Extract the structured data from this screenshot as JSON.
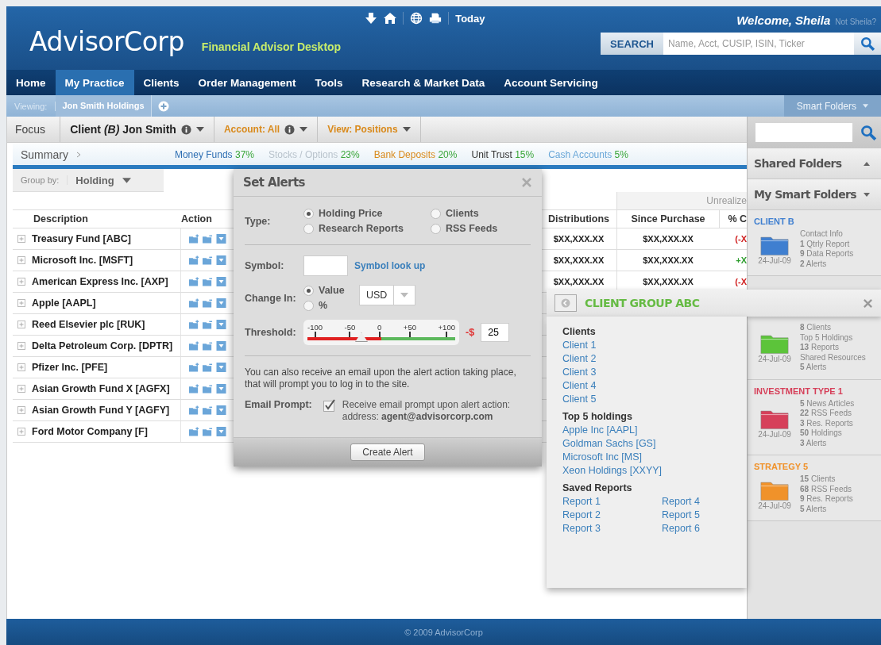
{
  "header": {
    "logo": "AdvisorCorp",
    "tagline": "Financial Advisor Desktop",
    "today": "Today",
    "welcome": "Welcome, Sheila",
    "not_user": "Not Sheila?",
    "search": {
      "button": "SEARCH",
      "placeholder": "Name, Acct, CUSIP, ISIN, Ticker"
    }
  },
  "nav": [
    {
      "label": "Home",
      "selected": false
    },
    {
      "label": "My Practice",
      "selected": true
    },
    {
      "label": "Clients",
      "selected": false
    },
    {
      "label": "Order Management",
      "selected": false
    },
    {
      "label": "Tools",
      "selected": false
    },
    {
      "label": "Research & Market Data",
      "selected": false
    },
    {
      "label": "Account Servicing",
      "selected": false
    }
  ],
  "subbar": {
    "viewing_label": "Viewing:",
    "viewing": "Jon Smith Holdings",
    "smart_folders": "Smart Folders"
  },
  "toolbar": {
    "focus": "Focus",
    "client": "Client *(B)* Jon Smith",
    "account": "Account: All",
    "view": "View: Positions"
  },
  "summary": {
    "title": "Summary",
    "items": [
      {
        "label": "Money Funds",
        "pct": "37%",
        "color": "#2f6fb3"
      },
      {
        "label": "Stocks / Options",
        "pct": "23%",
        "color": "#b9c3cc"
      },
      {
        "label": "Bank Deposits",
        "pct": "20%",
        "color": "#d98a1c"
      },
      {
        "label": "Unit Trust",
        "pct": "15%",
        "color": "#333333"
      },
      {
        "label": "Cash Accounts",
        "pct": "5%",
        "color": "#6aa7d8"
      }
    ]
  },
  "group_by": {
    "label": "Group by:",
    "value": "Holding"
  },
  "table": {
    "group_header": "Unrealize",
    "columns": [
      "Description",
      "Action",
      "Distributions",
      "Since Purchase",
      "% C"
    ],
    "rows": [
      {
        "description": "Treasury Fund [ABC]",
        "distributions": "$XX,XXX.XX",
        "since_purchase": "$XX,XXX.XX",
        "change": {
          "text": "(-X",
          "kind": "loss"
        }
      },
      {
        "description": "Microsoft Inc. [MSFT]",
        "distributions": "$XX,XXX.XX",
        "since_purchase": "$XX,XXX.XX",
        "change": {
          "text": "+X",
          "kind": "gain"
        }
      },
      {
        "description": "American Express Inc. [AXP]",
        "distributions": "$XX,XXX.XX",
        "since_purchase": "$XX,XXX.XX",
        "change": {
          "text": "(-X",
          "kind": "loss"
        }
      },
      {
        "description": "Apple [AAPL]"
      },
      {
        "description": "Reed Elsevier plc [RUK]"
      },
      {
        "description": "Delta Petroleum Corp. [DPTR]"
      },
      {
        "description": "Pfizer Inc. [PFE]"
      },
      {
        "description": "Asian Growth Fund X [AGFX]"
      },
      {
        "description": "Asian Growth Fund Y [AGFY]"
      },
      {
        "description": "Ford Motor Company [F]"
      }
    ]
  },
  "set_alerts": {
    "title": "Set Alerts",
    "type_label": "Type:",
    "types": [
      {
        "label": "Holding Price",
        "selected": true
      },
      {
        "label": "Clients",
        "selected": false
      },
      {
        "label": "Research Reports",
        "selected": false
      },
      {
        "label": "RSS Feeds",
        "selected": false
      }
    ],
    "symbol_label": "Symbol:",
    "symbol_link": "Symbol look up",
    "change_label": "Change In:",
    "change_options": [
      {
        "label": "Value",
        "selected": true
      },
      {
        "label": "%",
        "selected": false
      }
    ],
    "currency": "USD",
    "threshold_label": "Threshold:",
    "ticks": [
      "-100",
      "-50",
      "0",
      "+50",
      "+100"
    ],
    "threshold": {
      "level": 0.36,
      "prefix": "-$",
      "value": "25"
    },
    "note": "You can also receive an email upon the alert action taking place, that will prompt you to log in to the site.",
    "email_label": "Email Prompt:",
    "email": {
      "checked": true,
      "text": "Receive email prompt upon alert action: address: **agent@advisorcorp.com**"
    },
    "button": "Create Alert"
  },
  "client_group": {
    "title": "CLIENT GROUP ABC",
    "sections": [
      {
        "heading": "Clients",
        "kind": "list",
        "links": [
          "Client 1",
          "Client 2",
          "Client 3",
          "Client 4",
          "Client 5"
        ]
      },
      {
        "heading": "Top 5 holdings",
        "kind": "list",
        "links": [
          "Apple Inc [AAPL]",
          "Goldman Sachs [GS]",
          "Microsoft Inc [MS]",
          "Xeon Holdings [XXYY]"
        ]
      },
      {
        "heading": "Saved Reports",
        "kind": "grid",
        "links": [
          "Report 1",
          "Report 2",
          "Report 3",
          "Report 4",
          "Report 5",
          "Report 6"
        ]
      }
    ]
  },
  "sidebar": {
    "sections": [
      {
        "label": "Shared Folders",
        "expanded": false
      },
      {
        "label": "My Smart Folders",
        "expanded": true
      }
    ],
    "folders": [
      {
        "title": "CLIENT B",
        "color": "#3f7fd0",
        "date": "24-Jul-09",
        "lines": [
          "Contact Info",
          "**1** Qtrly Report",
          "**9** Data Reports",
          "**2** Alerts"
        ]
      },
      {
        "color": "#5cc43a",
        "date": "24-Jul-09",
        "lines": [
          "**8** Clients",
          "Top 5 Holdings",
          "**13** Reports",
          "Shared Resources",
          "**5** Alerts"
        ]
      },
      {
        "title": "INVESTMENT TYPE 1",
        "color": "#d6405a",
        "date": "24-Jul-09",
        "lines": [
          "**5** News Articles",
          "**22** RSS Feeds",
          "**3** Res. Reports",
          "**50** Holdings",
          "**3** Alerts"
        ]
      },
      {
        "title": "STRATEGY 5",
        "color": "#f0922a",
        "date": "24-Jul-09",
        "lines": [
          "**15** Clients",
          "**68** RSS Feeds",
          "**9** Res. Reports",
          "**5** Alerts"
        ]
      }
    ]
  },
  "footer": "© 2009 AdvisorCorp"
}
